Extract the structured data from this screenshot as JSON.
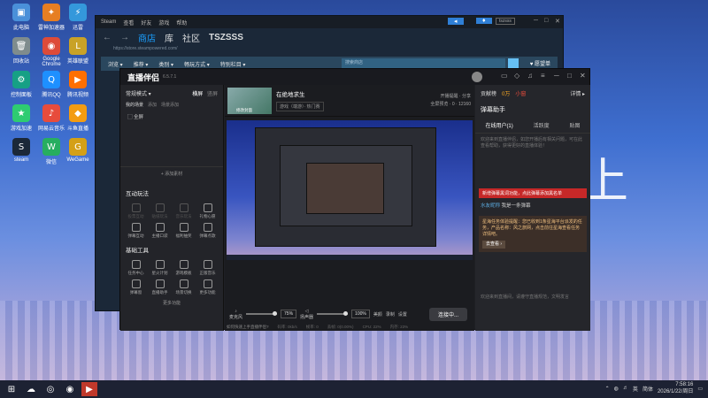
{
  "desktop": {
    "icons": [
      {
        "label": "此电脑",
        "color": "#4a90d9",
        "glyph": "▣"
      },
      {
        "label": "雷神加速器",
        "color": "#e67e22",
        "glyph": "✦"
      },
      {
        "label": "迅雷",
        "color": "#3498db",
        "glyph": "⚡"
      },
      {
        "label": "回收站",
        "color": "#7f8c8d",
        "glyph": "🗑"
      },
      {
        "label": "Google Chrome",
        "color": "#dd4b39",
        "glyph": "◉"
      },
      {
        "label": "英雄联盟",
        "color": "#c9a227",
        "glyph": "L"
      },
      {
        "label": "控制面板",
        "color": "#16a085",
        "glyph": "⚙"
      },
      {
        "label": "腾讯QQ",
        "color": "#1e90ff",
        "glyph": "Q"
      },
      {
        "label": "腾讯视频",
        "color": "#ff6f00",
        "glyph": "▶"
      },
      {
        "label": "游戏加速",
        "color": "#2ecc71",
        "glyph": "★"
      },
      {
        "label": "网易云音乐",
        "color": "#e74c3c",
        "glyph": "♪"
      },
      {
        "label": "斗鱼直播",
        "color": "#f39c12",
        "glyph": "◆"
      },
      {
        "label": "steam",
        "color": "#1b2838",
        "glyph": "S"
      },
      {
        "label": "微信",
        "color": "#27ae60",
        "glyph": "W"
      },
      {
        "label": "WeGame",
        "color": "#d4a017",
        "glyph": "G"
      }
    ]
  },
  "steam": {
    "title_items": [
      "Steam",
      "查看",
      "好友",
      "游戏",
      "帮助"
    ],
    "nav": [
      "商店",
      "库",
      "社区",
      "TSZSSS"
    ],
    "url": "https://store.steampowered.com/",
    "store_menu": [
      "浏览 ▾",
      "推荐 ▾",
      "类别 ▾",
      "畅玩方式 ▾",
      "特别栏目 ▾"
    ],
    "search_placeholder": "搜索商店",
    "wishlist": "♥ 愿望单",
    "user": "tszsss"
  },
  "live": {
    "app_name": "直播伴侣",
    "version": "6.5.7.1",
    "mode_label": "常规模式 ▾",
    "mode_options": [
      "横屏",
      "竖屏"
    ],
    "scene_tabs": [
      "我的场景",
      "添加",
      "场景添加"
    ],
    "scene_item": "全屏",
    "add_source": "+ 添加素材",
    "interactive_title": "互动玩法",
    "interactive_tools": [
      "投票互动",
      "贴纸玩法",
      "音乐玩法",
      "礼物心愿",
      "弹幕互动",
      "主播口袋",
      "福利抽奖",
      "弹幕点歌"
    ],
    "basic_title": "基础工具",
    "basic_tools": [
      "任务中心",
      "星火计划",
      "游戏模板",
      "正版音乐",
      "弹幕窗",
      "直播助手",
      "场景切换",
      "更多功能"
    ],
    "more_label": "更多功能",
    "stream_title": "在绝地求生",
    "change_cover": "修改封面",
    "category": "游戏（端游）· 热门赛",
    "stream_stats": [
      "开播提醒",
      "分享",
      "全屏预览",
      "0",
      "12160"
    ],
    "mic_label": "麦克风",
    "mic_pct": "75%",
    "speaker_label": "扬声器",
    "speaker_pct": "100%",
    "ctrl_icons": [
      "美颜",
      "录制",
      "设置"
    ],
    "go_live": "连接中...",
    "bottom_link": "如何快速上手直播伴侣?",
    "status_items": [
      "码率: 0kb/s",
      "帧率: 0",
      "丢帧: 0(0.00%)",
      "CPU: 22%",
      "内存: 23%",
      "网络: 良好"
    ],
    "right": {
      "stats": [
        "贡献榜",
        "0万",
        "小窗",
        "详情 ▸"
      ],
      "danmu_title": "弹幕助手",
      "tabs": [
        "在线用户(1)",
        "活跃度",
        "贴图"
      ],
      "welcome": "欢迎来到直播伴侣，如您开播后有相关问题，可在此查看帮助，获得更好的直播体验！",
      "notice": "新增弹幕黑词功能，点此弹幕添加黑名单",
      "user_name": "水友昵称",
      "user_msg": "我是一条弹幕",
      "task_text": "星海任务体验提醒：您已收到1条星海平台派发的任务，产品名称：风之旅网，点击前往星海查看任务详情吧。",
      "task_link": "去查看 ›",
      "footer_msg": "欢迎来到直播间，请遵守直播规范，文明发言"
    }
  },
  "taskbar": {
    "time": "7:58:16",
    "date": "2026/1/22/周日",
    "lang": "英",
    "input": "简体"
  }
}
